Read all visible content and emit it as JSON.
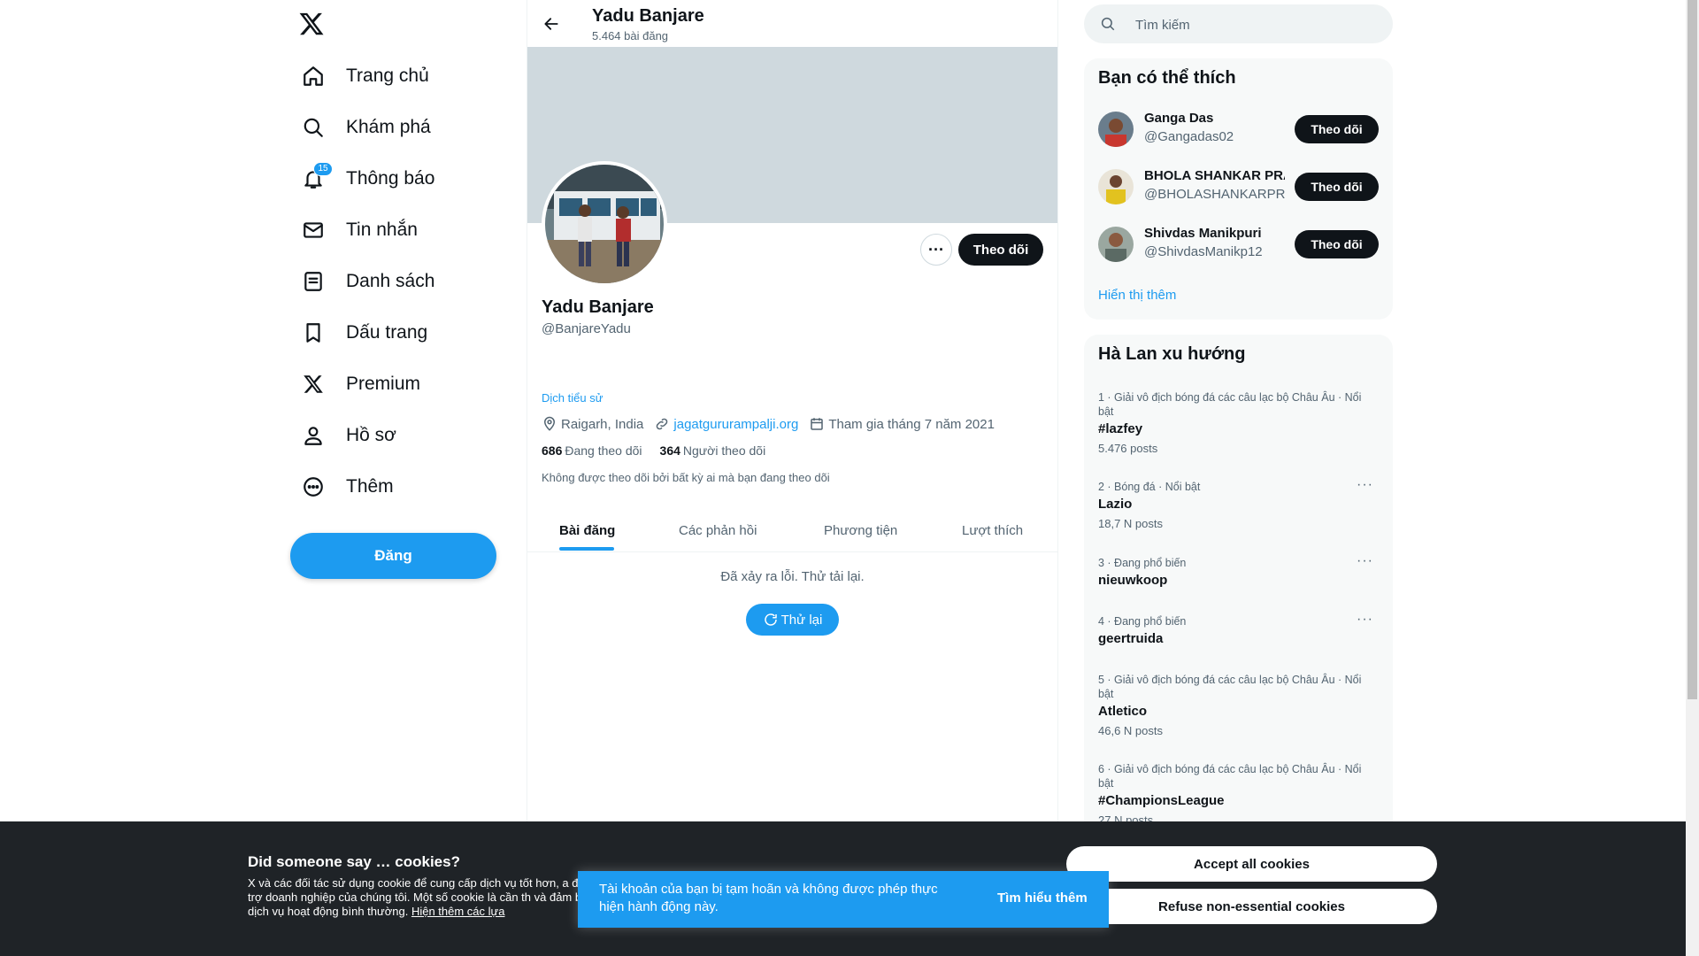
{
  "nav": {
    "items": [
      {
        "label": "Trang chủ",
        "icon": "home-icon"
      },
      {
        "label": "Khám phá",
        "icon": "search-icon"
      },
      {
        "label": "Thông báo",
        "icon": "bell-icon",
        "badge": "15"
      },
      {
        "label": "Tin nhắn",
        "icon": "mail-icon"
      },
      {
        "label": "Danh sách",
        "icon": "list-icon"
      },
      {
        "label": "Dấu trang",
        "icon": "bookmark-icon"
      },
      {
        "label": "Premium",
        "icon": "x-logo-icon"
      },
      {
        "label": "Hồ sơ",
        "icon": "person-icon"
      },
      {
        "label": "Thêm",
        "icon": "more-circle-icon"
      }
    ],
    "post_label": "Đăng"
  },
  "header": {
    "name": "Yadu Banjare",
    "post_count": "5.464 bài đăng"
  },
  "profile": {
    "name": "Yadu Banjare",
    "handle": "@BanjareYadu",
    "follow_label": "Theo dõi",
    "more_label": "···",
    "translate_bio": "Dịch tiểu sử",
    "location": "Raigarh, India",
    "website": "jagatgururampalji.org",
    "joined": "Tham gia tháng 7 năm 2021",
    "following_count": "686",
    "following_label": "Đang theo dõi",
    "followers_count": "364",
    "followers_label": "Người theo dõi",
    "not_followed": "Không được theo dõi bởi bất kỳ ai mà bạn đang theo dõi"
  },
  "tabs": [
    "Bài đăng",
    "Các phản hồi",
    "Phương tiện",
    "Lượt thích"
  ],
  "error": {
    "message": "Đã xảy ra lỗi. Thử tải lại.",
    "retry_label": "Thử lại"
  },
  "search": {
    "placeholder": "Tìm kiếm"
  },
  "who_to_follow": {
    "title": "Bạn có thể thích",
    "users": [
      {
        "name": "Ganga Das",
        "handle": "@Gangadas02",
        "button": "Theo dõi"
      },
      {
        "name": "BHOLA SHANKAR PRASAD",
        "handle": "@BHOLASHANKARPRSD",
        "button": "Theo dõi"
      },
      {
        "name": "Shivdas Manikpuri",
        "handle": "@ShivdasManikp12",
        "button": "Theo dõi"
      }
    ],
    "show_more": "Hiển thị thêm"
  },
  "trends": {
    "title": "Hà Lan xu hướng",
    "items": [
      {
        "context": "1 · Giải vô địch bóng đá các câu lạc bộ Châu Âu · Nổi bật",
        "name": "#lazfey",
        "count": "5.476 posts"
      },
      {
        "context": "2 · Bóng đá · Nổi bật",
        "name": "Lazio",
        "count": "18,7 N posts"
      },
      {
        "context": "3 · Đang phổ biến",
        "name": "nieuwkoop",
        "count": ""
      },
      {
        "context": "4 · Đang phổ biến",
        "name": "geertruida",
        "count": ""
      },
      {
        "context": "5 · Giải vô địch bóng đá các câu lạc bộ Châu Âu · Nổi bật",
        "name": "Atletico",
        "count": "46,6 N posts"
      },
      {
        "context": "6 · Giải vô địch bóng đá các câu lạc bộ Châu Âu · Nổi bật",
        "name": "#ChampionsLeague",
        "count": "27 N posts"
      }
    ]
  },
  "cookie": {
    "title": "Did someone say … cookies?",
    "text": "X và các đối tác sử dụng cookie để cung cấp dịch vụ tốt hơn, a để hỗ trợ doanh nghiệp của chúng tôi. Một số cookie là cần th và đảm bảo dịch vụ hoạt động bình thường.",
    "link": "Hiện thêm các lựa",
    "accept_label": "Accept all cookies",
    "refuse_label": "Refuse non-essential cookies"
  },
  "toast": {
    "text": "Tài khoản của bạn bị tạm hoãn và không được phép thực hiện hành động này.",
    "link": "Tìm hiểu thêm"
  },
  "colors": {
    "accent": "#1d9bf0",
    "text": "#0f1419",
    "muted": "#536471",
    "banner": "#cfd9de",
    "cookie_bg": "#1f2327"
  }
}
